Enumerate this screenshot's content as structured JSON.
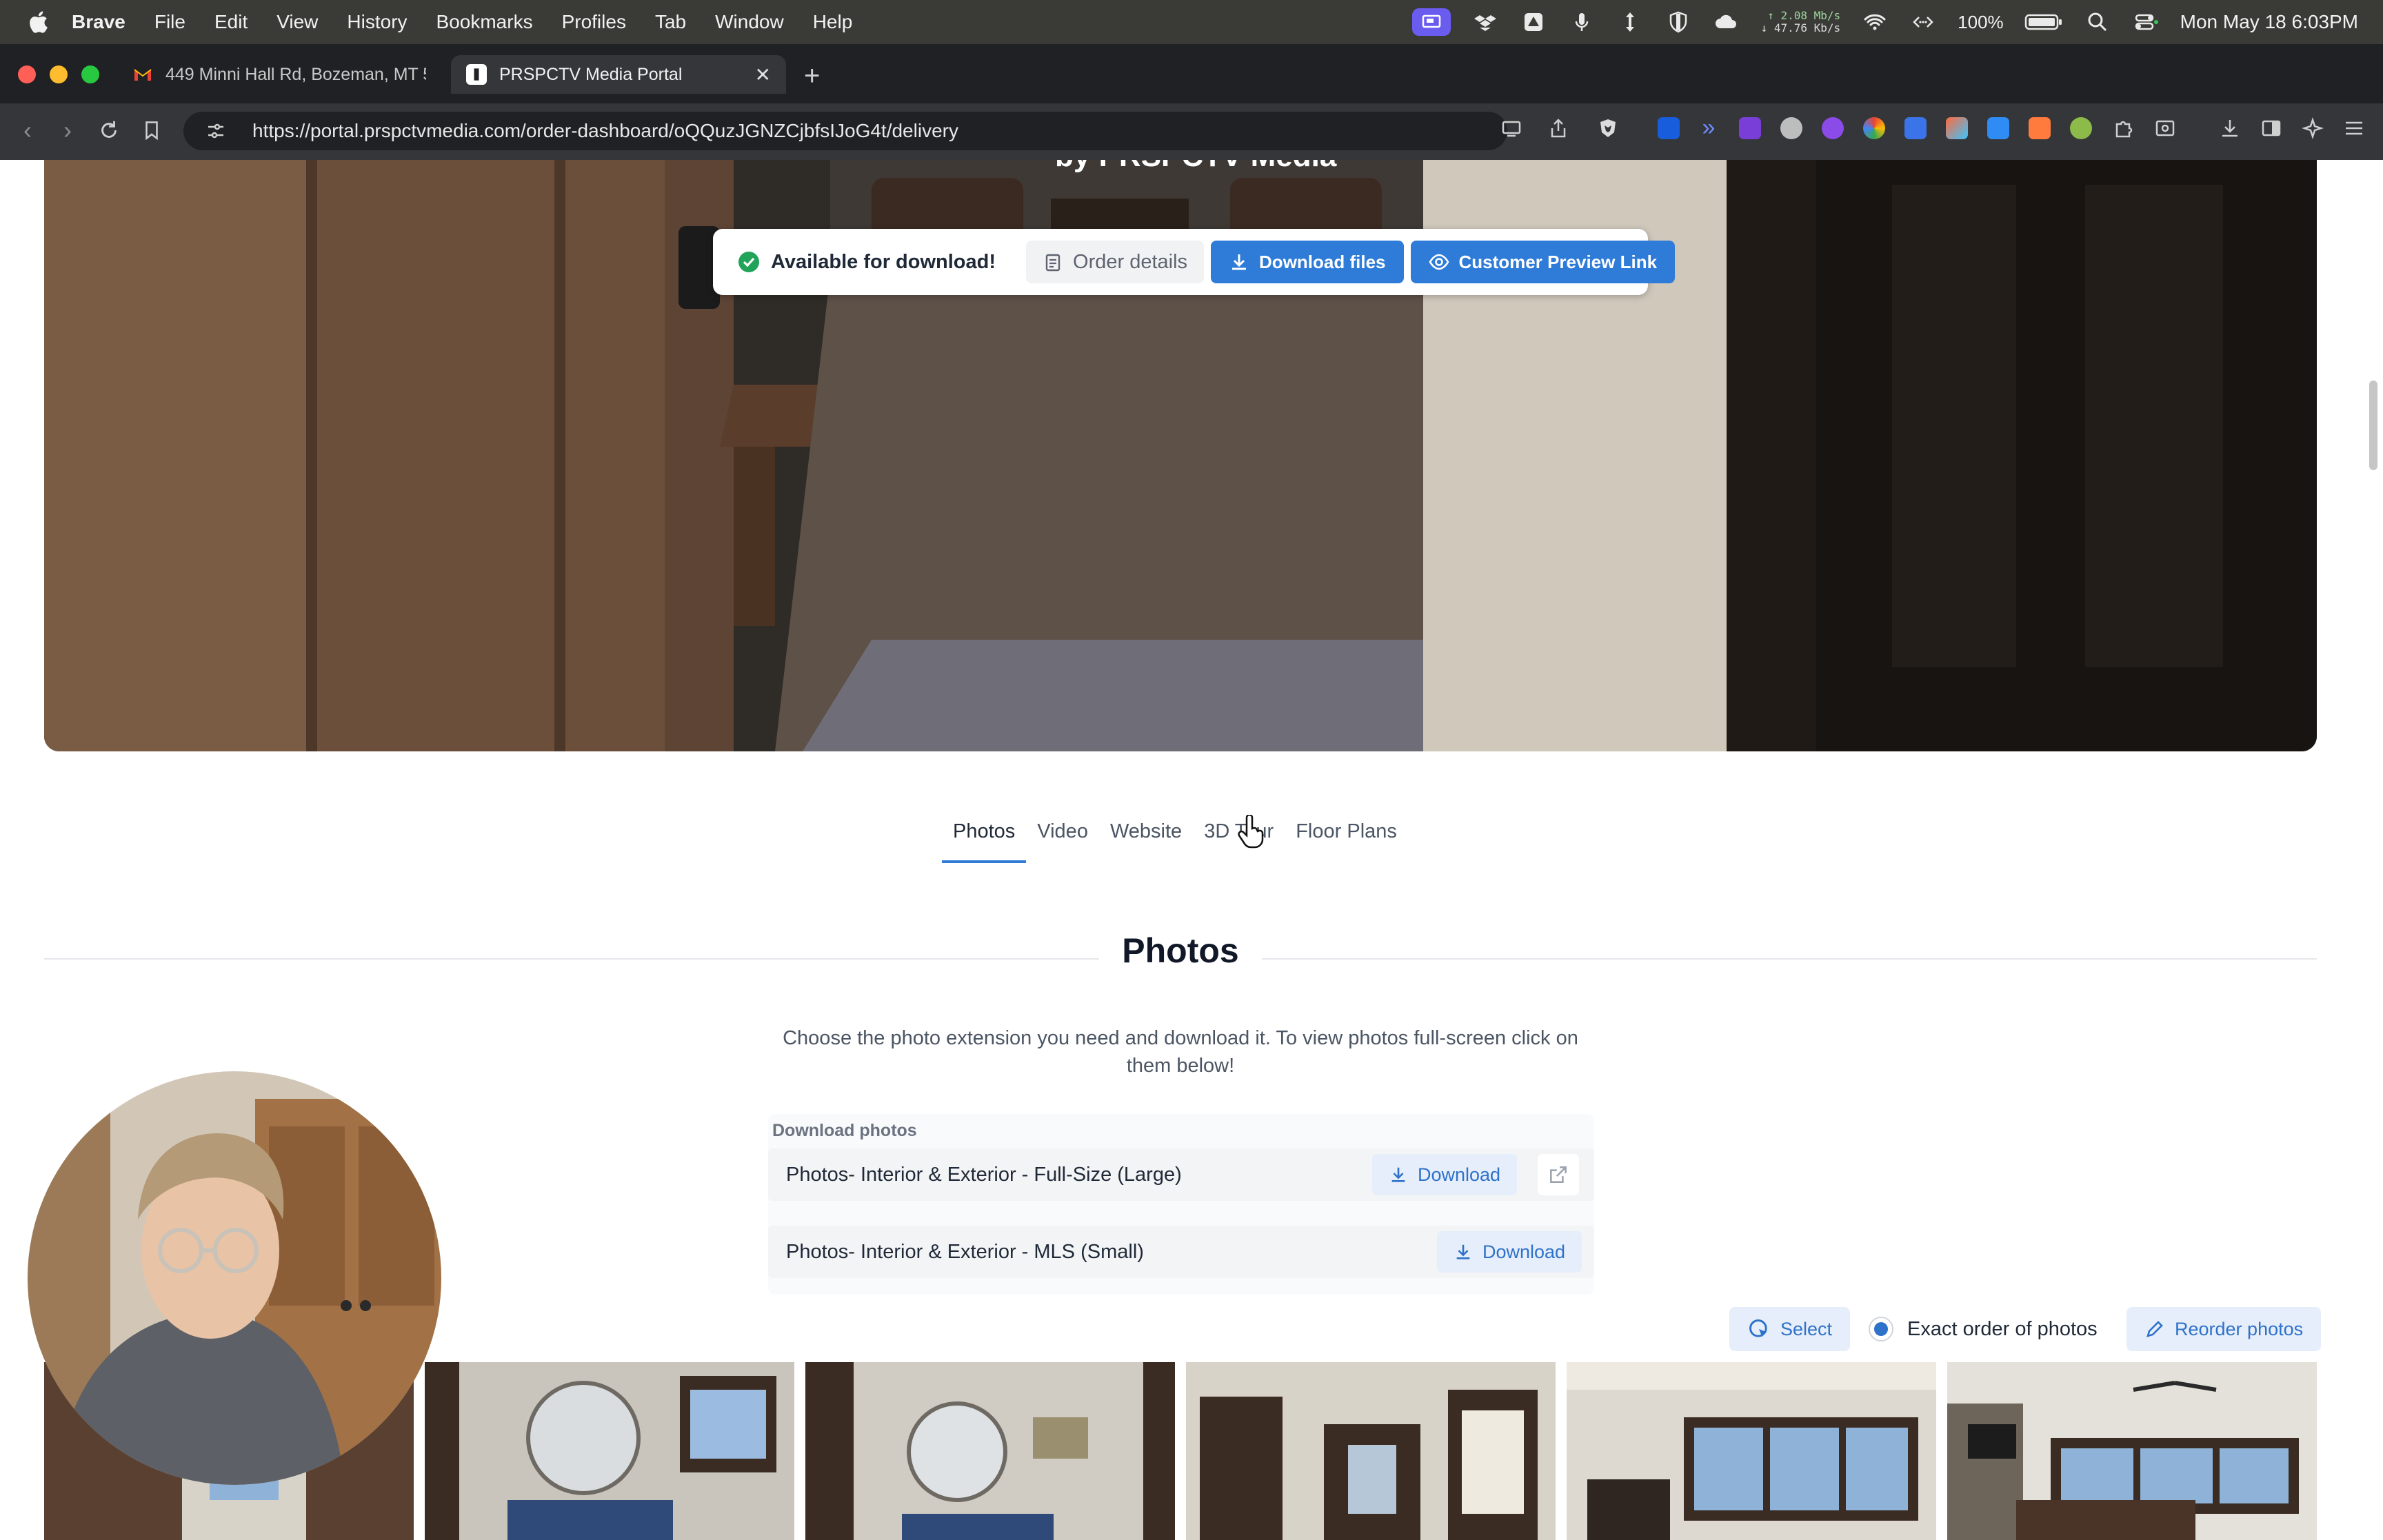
{
  "menubar": {
    "app": "Brave",
    "items": [
      "File",
      "Edit",
      "View",
      "History",
      "Bookmarks",
      "Profiles",
      "Tab",
      "Window",
      "Help"
    ],
    "net_up": "↑ 2.08 Mb/s",
    "net_down": "↓ 47.76 Kb/s",
    "battery": "100%",
    "clock": "Mon May 18  6:03PM"
  },
  "browser": {
    "tabs": [
      {
        "title": "449 Minni Hall Rd, Bozeman, MT 5",
        "favicon": "gmail-icon"
      },
      {
        "title": "PRSPCTV Media Portal",
        "favicon": "prspctv-icon"
      }
    ],
    "url": "https://portal.prspctvmedia.com/order-dashboard/oQQuzJGNZCjbfsIJoG4t/delivery"
  },
  "hero": {
    "caption": "by PRSPCTV Media"
  },
  "download_bar": {
    "status": "Available for download!",
    "order_details": "Order details",
    "download_files": "Download files",
    "customer_preview": "Customer Preview Link"
  },
  "tabs": [
    "Photos",
    "Video",
    "Website",
    "3D Tour",
    "Floor Plans"
  ],
  "active_tab": "Photos",
  "photos": {
    "title": "Photos",
    "description": "Choose the photo extension you need and download it. To view photos full-screen click on them below!",
    "download_heading": "Download photos",
    "options": [
      {
        "label": "Photos- Interior & Exterior - Full-Size (Large)",
        "button": "Download"
      },
      {
        "label": "Photos- Interior & Exterior - MLS (Small)",
        "button": "Download"
      }
    ],
    "select_label": "Select",
    "exact_order_label": "Exact order of photos",
    "reorder_label": "Reorder photos"
  },
  "colors": {
    "accent": "#2e7bd8",
    "success": "#22a35a",
    "menubar": "#3a3b36"
  }
}
